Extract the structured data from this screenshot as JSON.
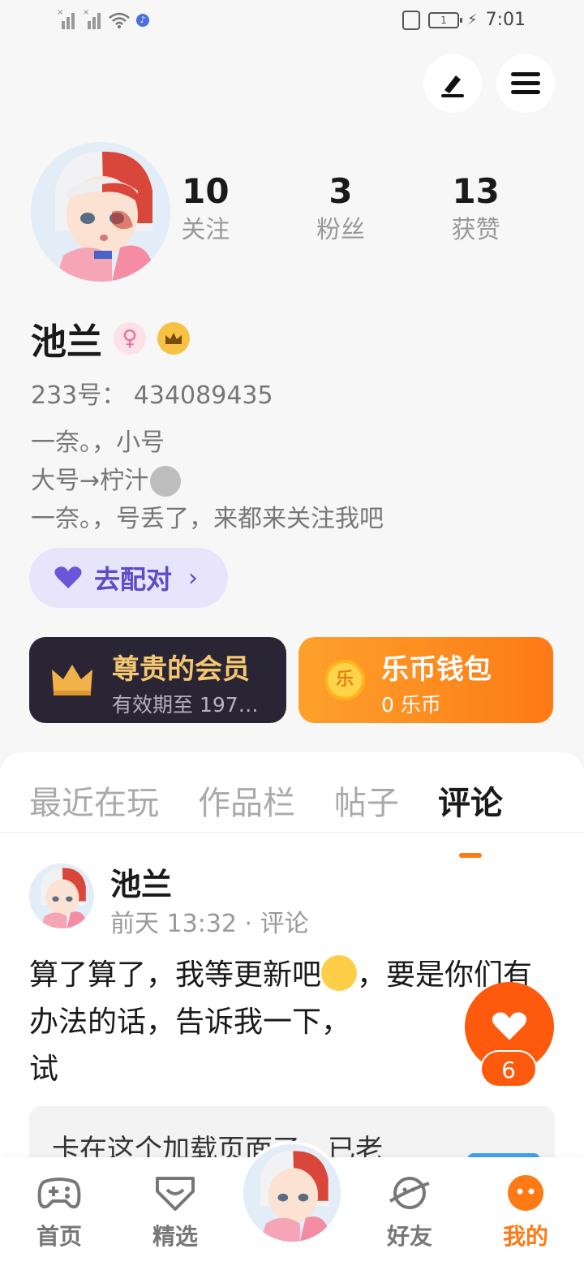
{
  "status_bar": {
    "time": "7:01",
    "battery": "1"
  },
  "profile": {
    "stats": [
      {
        "value": "10",
        "label": "关注"
      },
      {
        "value": "3",
        "label": "粉丝"
      },
      {
        "value": "13",
        "label": "获赞"
      }
    ],
    "name": "池兰",
    "uid": "233号：  434089435",
    "bio_lines": [
      "一奈。，小号",
      "大号→柠汁",
      "一奈。，号丢了，来都来关注我吧"
    ],
    "match_label": "去配对"
  },
  "cards": {
    "vip_title": "尊贵的会员",
    "vip_sub": "有效期至 197…",
    "wallet_title": "乐币钱包",
    "wallet_sub": "0 乐币",
    "coin_char": "乐"
  },
  "tabs": [
    "最近在玩",
    "作品栏",
    "帖子",
    "评论"
  ],
  "comment": {
    "name": "池兰",
    "meta": "前天 13:32 · 评论",
    "text_part1": "算了算了，我等更新吧",
    "text_part2": "，要是你们有办法的话，告诉我一下，",
    "text_part3": "试",
    "quote": "卡在这个加载页面了，已老",
    "likes": "6"
  },
  "nav": [
    "首页",
    "精选",
    "好友",
    "我的"
  ],
  "colors": {
    "accent": "#fd7a15",
    "like": "#fd5a0e",
    "match_bg": "#e8e4fb",
    "vip_bg": "#2a2535"
  }
}
